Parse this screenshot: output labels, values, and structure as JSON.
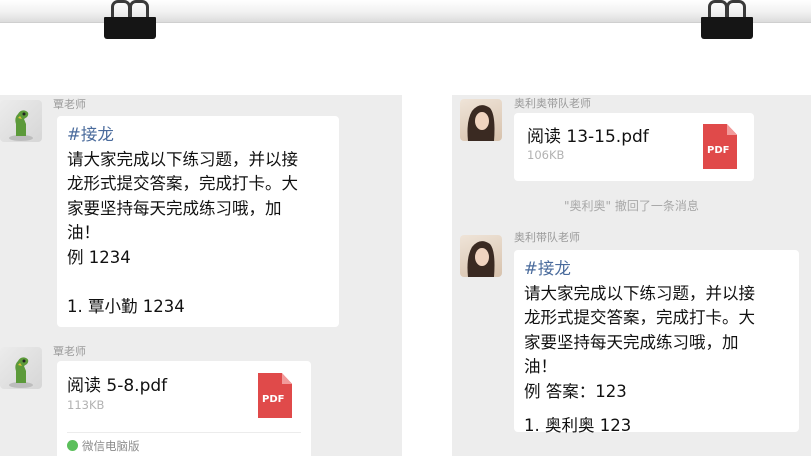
{
  "left": {
    "sender_1": "覃老师",
    "text_message": {
      "hashtag": "#接龙",
      "body_lines": [
        "请大家完成以下练习题，并以接",
        "龙形式提交答案，完成打卡。大",
        "家要坚持每天完成练习哦，加",
        "油！",
        "例 1234"
      ],
      "entry": "1. 覃小勤 1234"
    },
    "sender_2": "覃老师",
    "file_message": {
      "file_name": "阅读 5-8.pdf",
      "file_size": "113KB",
      "icon_label": "PDF",
      "client_label": "微信电脑版"
    }
  },
  "right": {
    "sender_1": "奥利奥带队老师",
    "file_message": {
      "file_name": "阅读 13-15.pdf",
      "file_size": "106KB",
      "icon_label": "PDF"
    },
    "recall_notice": "\"奥利奥\" 撤回了一条消息",
    "sender_2": "奥利带队老师",
    "text_message": {
      "hashtag": "#接龙",
      "body_lines": [
        "请大家完成以下练习题，并以接",
        "龙形式提交答案，完成打卡。大",
        "家要坚持每天完成练习哦，加",
        "油！",
        "例 答案：123"
      ],
      "entry": "1. 奥利奥 123"
    }
  },
  "colors": {
    "chat_background": "#ededed",
    "bubble": "#ffffff",
    "hashtag": "#4a6b9c",
    "pdf_icon": "#e04a4a"
  }
}
